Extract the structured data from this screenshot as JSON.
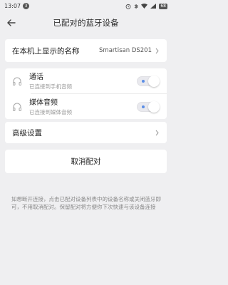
{
  "status": {
    "time": "13:07",
    "notification_count": "3",
    "battery": "68"
  },
  "header": {
    "title": "已配对的蓝牙设备"
  },
  "device_name": {
    "label": "在本机上显示的名称",
    "value": "Smartisan DS201"
  },
  "profiles": [
    {
      "name": "通话",
      "status": "已连接到手机音频",
      "enabled": true
    },
    {
      "name": "媒体音频",
      "status": "已连接到媒体音频",
      "enabled": true
    }
  ],
  "advanced": {
    "label": "高级设置"
  },
  "unpair": {
    "label": "取消配对"
  },
  "note": "如想断开连接，点击已配对设备列表中的设备名称或关闭蓝牙即可，不用取消配对。保留配对将方便你下次快速与该设备连接",
  "colors": {
    "background": "#efeff1",
    "toggle_dot": "#5b8ee6"
  }
}
